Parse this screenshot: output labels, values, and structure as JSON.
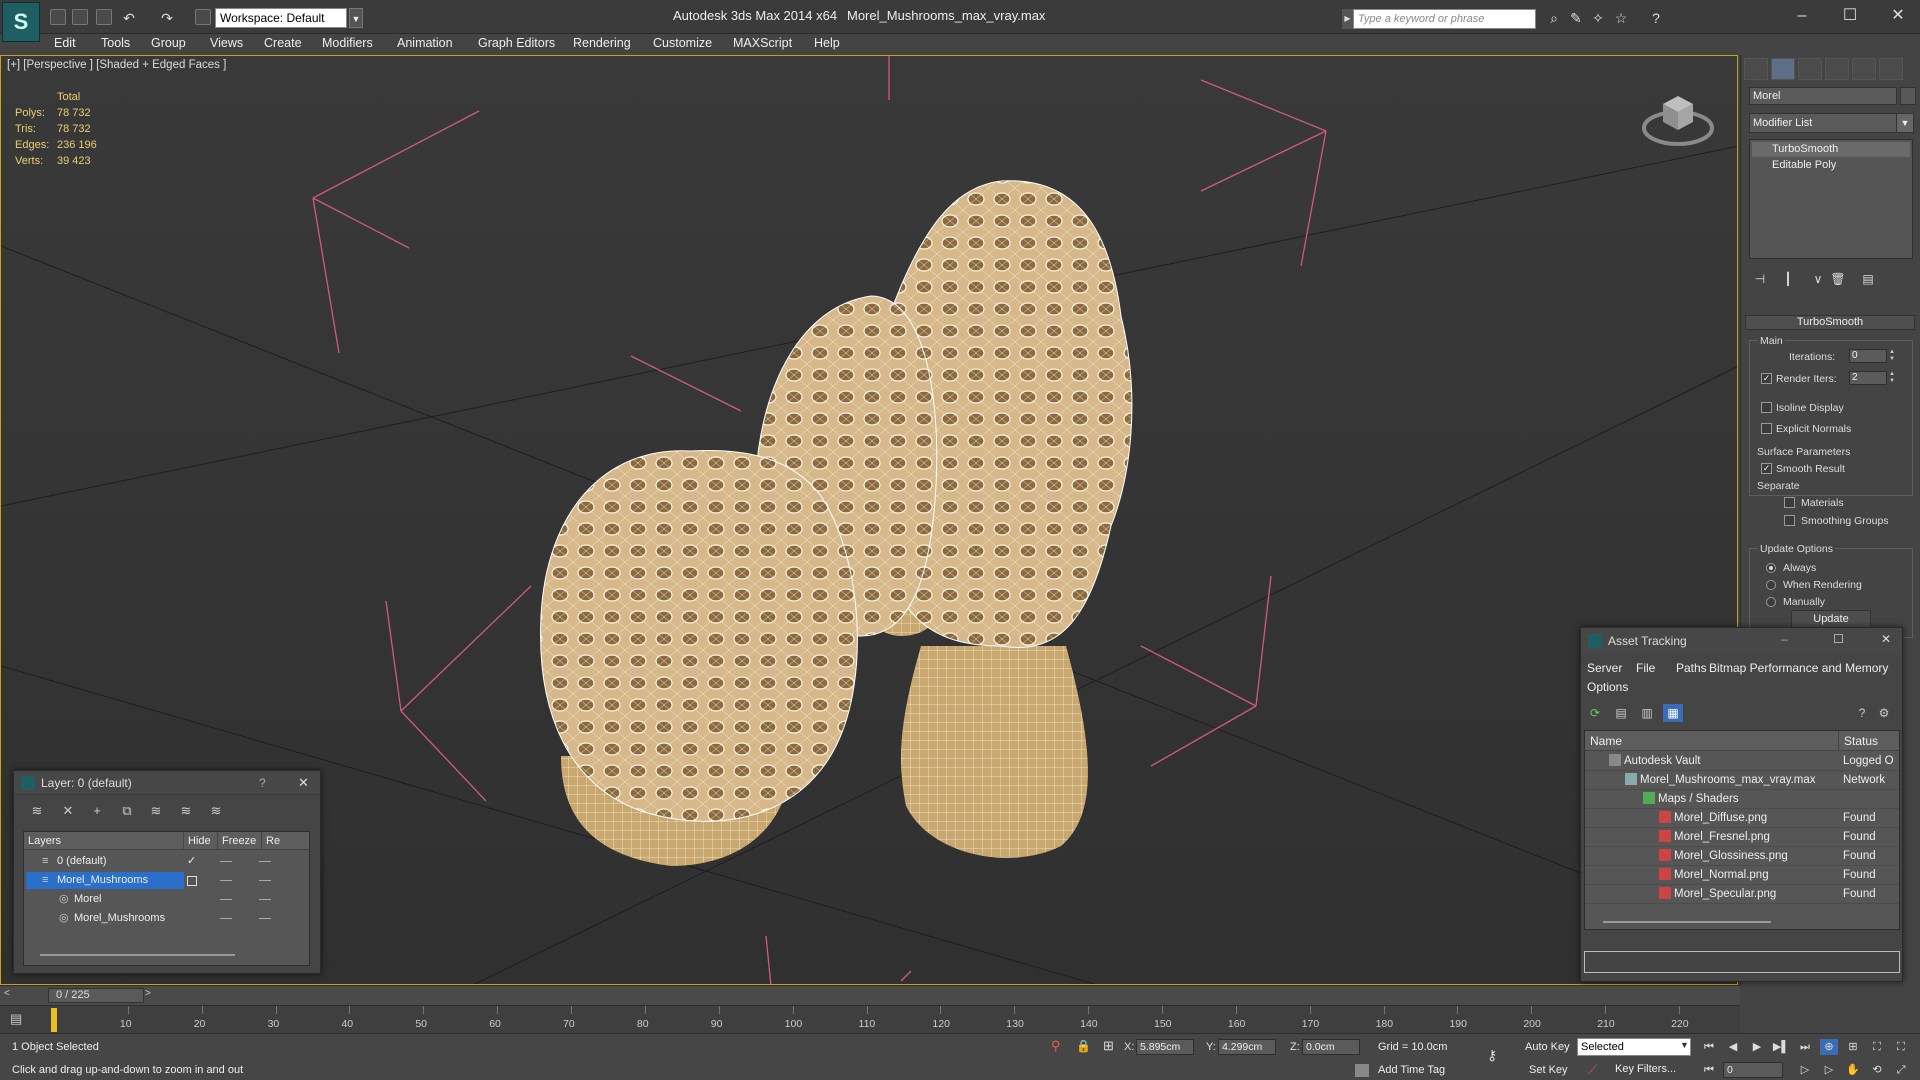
{
  "window": {
    "app_title": "Autodesk 3ds Max  2014 x64",
    "file_title": "Morel_Mushrooms_max_vray.max",
    "workspace": "Workspace: Default",
    "search_placeholder": "Type a keyword or phrase"
  },
  "menu": [
    "Edit",
    "Tools",
    "Group",
    "Views",
    "Create",
    "Modifiers",
    "Animation",
    "Graph Editors",
    "Rendering",
    "Customize",
    "MAXScript",
    "Help"
  ],
  "viewport": {
    "label": "[+] [Perspective ] [Shaded + Edged Faces ]",
    "stats": {
      "header": "Total",
      "rows": [
        {
          "label": "Polys:",
          "value": "78 732"
        },
        {
          "label": "Tris:",
          "value": "78 732"
        },
        {
          "label": "Edges:",
          "value": "236 196"
        },
        {
          "label": "Verts:",
          "value": "39 423"
        }
      ]
    }
  },
  "command_panel": {
    "object_name": "Morel",
    "modifier_list": "Modifier List",
    "stack": [
      "TurboSmooth",
      "Editable Poly"
    ],
    "rollout_title": "TurboSmooth",
    "main_group": "Main",
    "iterations_label": "Iterations:",
    "iterations_value": "0",
    "render_iters_label": "Render Iters:",
    "render_iters_value": "2",
    "isoline_display": "Isoline Display",
    "explicit_normals": "Explicit Normals",
    "surface_params": "Surface Parameters",
    "smooth_result": "Smooth Result",
    "separate": "Separate",
    "materials": "Materials",
    "smoothing_groups": "Smoothing Groups",
    "update_options": "Update Options",
    "always": "Always",
    "when_rendering": "When Rendering",
    "manually": "Manually",
    "update_button": "Update"
  },
  "layer_dialog": {
    "title": "Layer: 0 (default)",
    "help": "?",
    "columns": [
      "Layers",
      "Hide",
      "Freeze",
      "Re"
    ],
    "rows": [
      {
        "name": "0 (default)"
      },
      {
        "name": "Morel_Mushrooms"
      },
      {
        "name": "Morel"
      },
      {
        "name": "Morel_Mushrooms"
      }
    ]
  },
  "asset_dialog": {
    "title": "Asset Tracking",
    "menu": [
      "Server",
      "File",
      "Paths",
      "Bitmap Performance and Memory",
      "Options"
    ],
    "columns": [
      "Name",
      "Status"
    ],
    "rows": [
      {
        "name": "Autodesk Vault",
        "status": "Logged O"
      },
      {
        "name": "Morel_Mushrooms_max_vray.max",
        "status": "Network"
      },
      {
        "name": "Maps / Shaders",
        "status": ""
      },
      {
        "name": "Morel_Diffuse.png",
        "status": "Found"
      },
      {
        "name": "Morel_Fresnel.png",
        "status": "Found"
      },
      {
        "name": "Morel_Glossiness.png",
        "status": "Found"
      },
      {
        "name": "Morel_Normal.png",
        "status": "Found"
      },
      {
        "name": "Morel_Specular.png",
        "status": "Found"
      }
    ]
  },
  "timeline": {
    "frame_counter": "0 / 225",
    "ticks": [
      "10",
      "20",
      "30",
      "40",
      "50",
      "60",
      "70",
      "80",
      "90",
      "100",
      "110",
      "120",
      "130",
      "140",
      "150",
      "160",
      "170",
      "180",
      "190",
      "200",
      "210",
      "220"
    ]
  },
  "status": {
    "selection": "1 Object Selected",
    "hint": "Click and drag up-and-down to zoom in and out",
    "x_label": "X:",
    "x_value": "5.895cm",
    "y_label": "Y:",
    "y_value": "4.299cm",
    "z_label": "Z:",
    "z_value": "0.0cm",
    "grid": "Grid = 10.0cm",
    "add_time_tag": "Add Time Tag",
    "auto_key": "Auto Key",
    "set_key": "Set Key",
    "selected": "Selected",
    "key_filters": "Key Filters...",
    "frame": "0"
  },
  "colors": {
    "accent_yellow": "#c8a020",
    "stats_text": "#e8d070",
    "layer_selected": "#2a6fc9",
    "mushroom": "#c9a870",
    "bbox_pink": "#d05a7a"
  }
}
